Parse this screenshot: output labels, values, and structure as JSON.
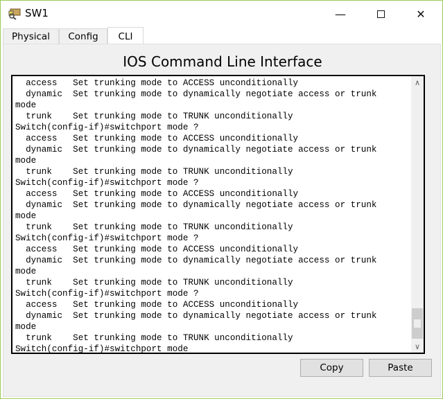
{
  "window": {
    "title": "SW1",
    "icon": "packet-tracer-switch-icon",
    "accent": "#9bcc5a"
  },
  "tabs": [
    {
      "label": "Physical"
    },
    {
      "label": "Config"
    },
    {
      "label": "CLI"
    }
  ],
  "cli": {
    "heading": "IOS Command Line Interface",
    "lines": [
      "  access   Set trunking mode to ACCESS unconditionally",
      "  dynamic  Set trunking mode to dynamically negotiate access or trunk",
      "mode",
      "  trunk    Set trunking mode to TRUNK unconditionally",
      "Switch(config-if)#switchport mode ?",
      "  access   Set trunking mode to ACCESS unconditionally",
      "  dynamic  Set trunking mode to dynamically negotiate access or trunk",
      "mode",
      "  trunk    Set trunking mode to TRUNK unconditionally",
      "Switch(config-if)#switchport mode ?",
      "  access   Set trunking mode to ACCESS unconditionally",
      "  dynamic  Set trunking mode to dynamically negotiate access or trunk",
      "mode",
      "  trunk    Set trunking mode to TRUNK unconditionally",
      "Switch(config-if)#switchport mode ?",
      "  access   Set trunking mode to ACCESS unconditionally",
      "  dynamic  Set trunking mode to dynamically negotiate access or trunk",
      "mode",
      "  trunk    Set trunking mode to TRUNK unconditionally",
      "Switch(config-if)#switchport mode ?",
      "  access   Set trunking mode to ACCESS unconditionally",
      "  dynamic  Set trunking mode to dynamically negotiate access or trunk",
      "mode",
      "  trunk    Set trunking mode to TRUNK unconditionally",
      "Switch(config-if)#switchport mode"
    ],
    "copy_label": "Copy",
    "paste_label": "Paste"
  }
}
